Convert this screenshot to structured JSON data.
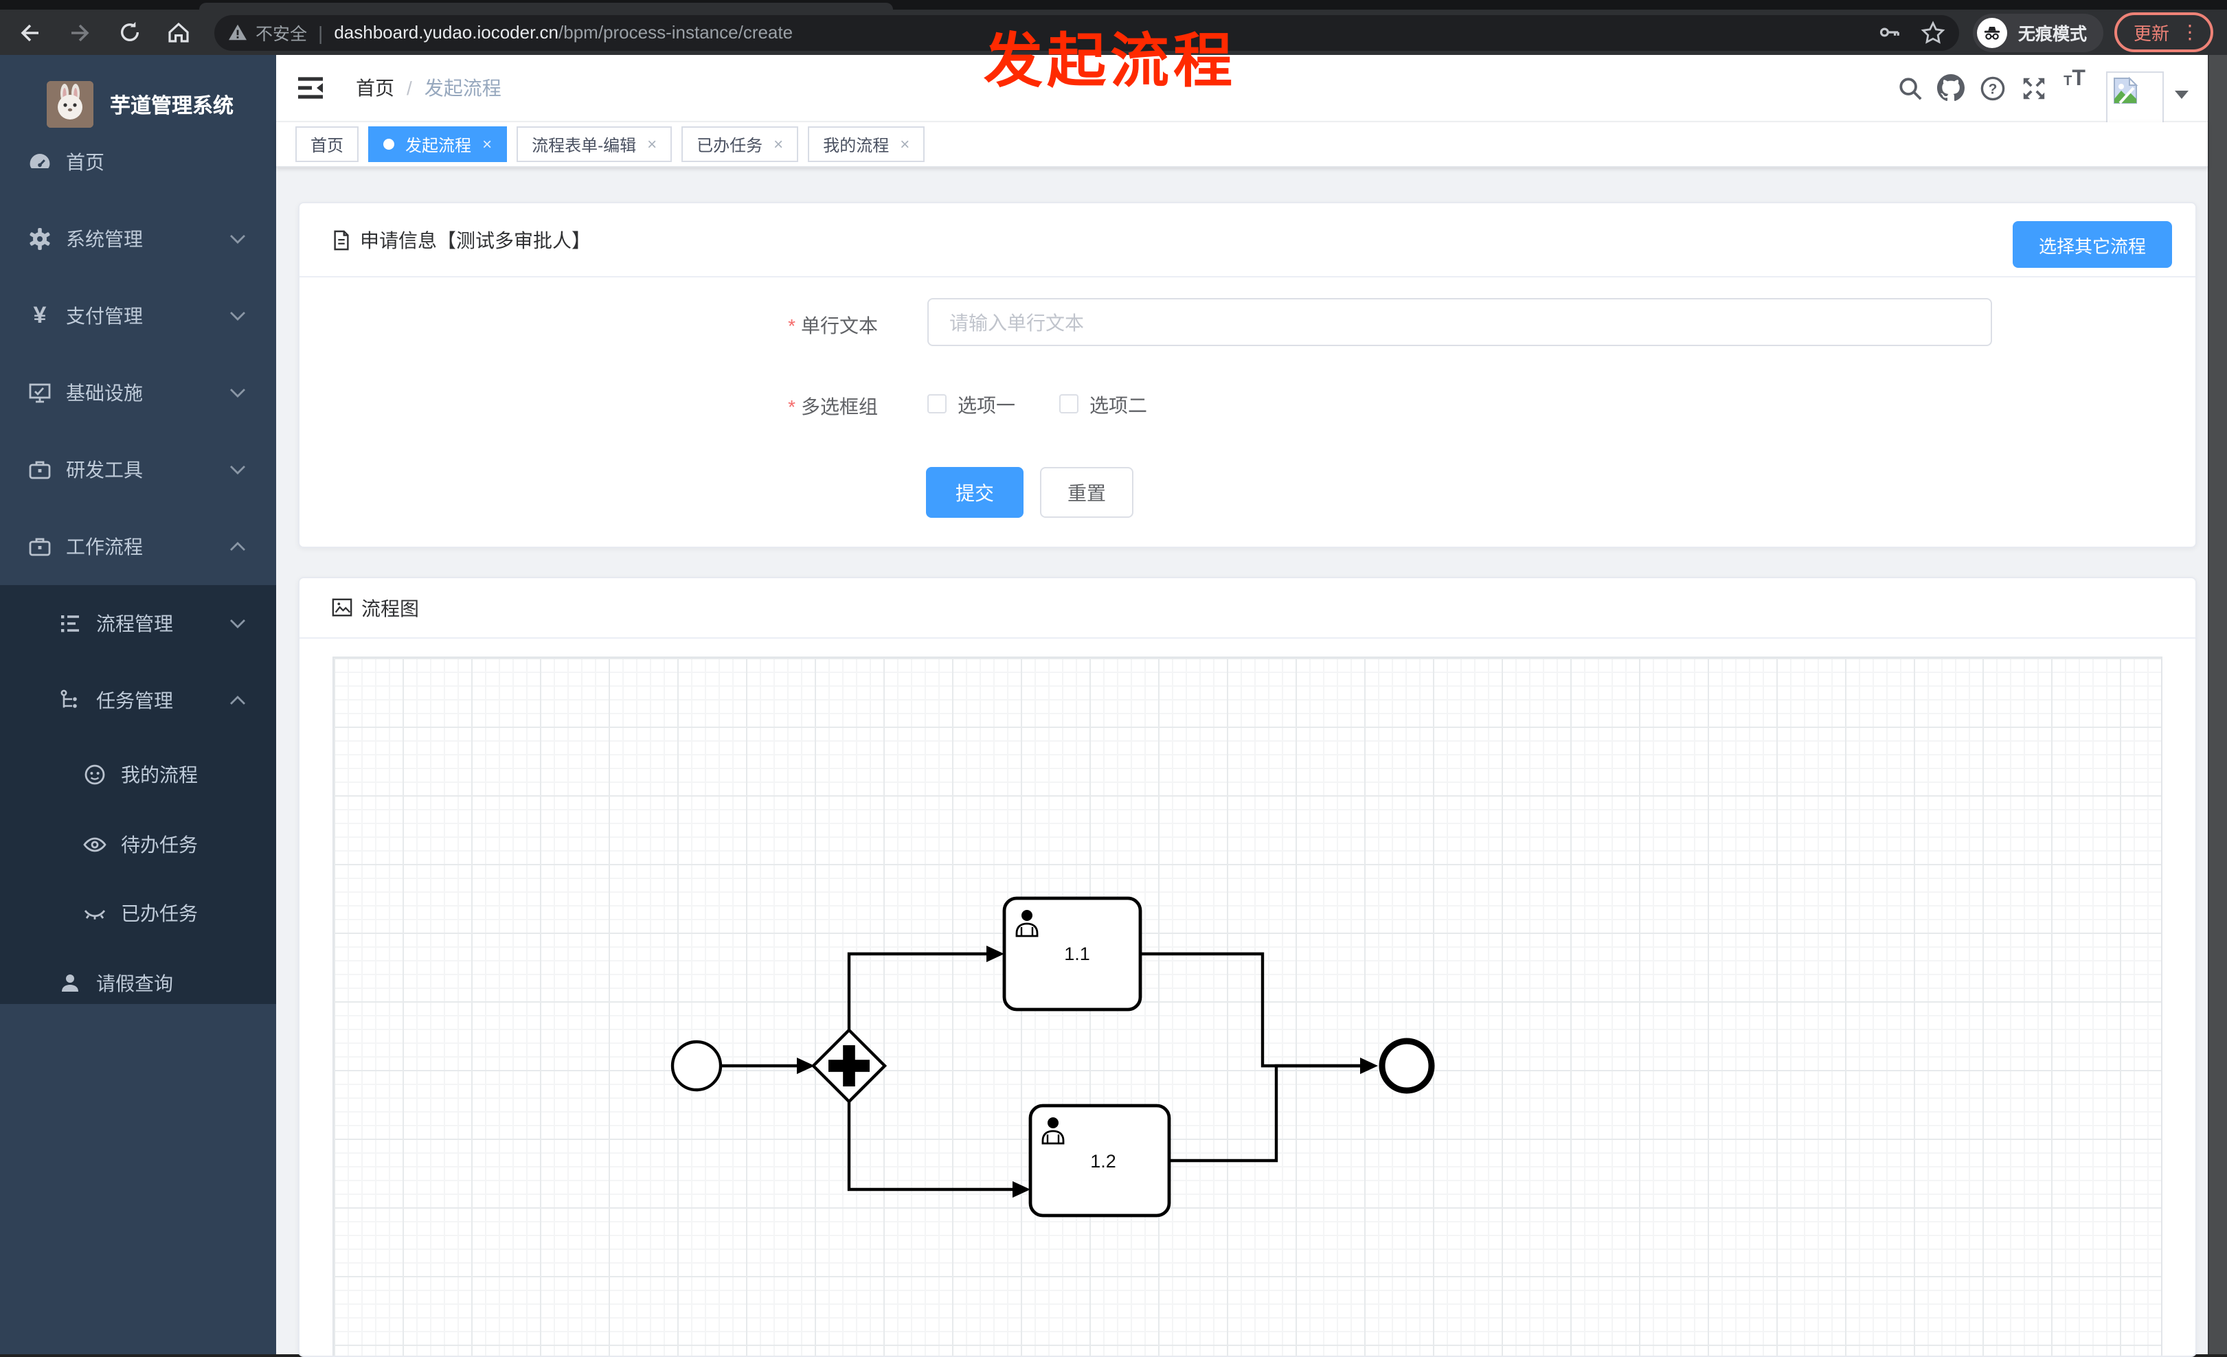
{
  "browser": {
    "security_label": "不安全",
    "url_host": "dashboard.yudao.iocoder.cn",
    "url_path": "/bpm/process-instance/create",
    "incognito_label": "无痕模式",
    "update_label": "更新"
  },
  "annotation": {
    "title": "发起流程",
    "color": "#ff2a00"
  },
  "sidebar": {
    "logo_title": "芋道管理系统",
    "items": [
      {
        "label": "首页",
        "icon": "dashboard"
      },
      {
        "label": "系统管理",
        "icon": "gear"
      },
      {
        "label": "支付管理",
        "icon": "yen"
      },
      {
        "label": "基础设施",
        "icon": "monitor"
      },
      {
        "label": "研发工具",
        "icon": "briefcase"
      },
      {
        "label": "工作流程",
        "icon": "briefcase",
        "expanded": true
      },
      {
        "label": "流程管理",
        "icon": "list"
      },
      {
        "label": "任务管理",
        "icon": "flow",
        "expanded": true
      },
      {
        "label": "我的流程",
        "icon": "face"
      },
      {
        "label": "待办任务",
        "icon": "eye"
      },
      {
        "label": "已办任务",
        "icon": "eye-off"
      },
      {
        "label": "请假查询",
        "icon": "user"
      }
    ]
  },
  "header": {
    "breadcrumb": [
      "首页",
      "发起流程"
    ],
    "separator": "/"
  },
  "tabs": [
    {
      "label": "首页"
    },
    {
      "label": "发起流程",
      "active": true
    },
    {
      "label": "流程表单-编辑"
    },
    {
      "label": "已办任务"
    },
    {
      "label": "我的流程"
    }
  ],
  "form_card": {
    "title": "申请信息【测试多审批人】",
    "select_other_button": "选择其它流程",
    "required_mark": "*",
    "fields": {
      "text": {
        "label": "单行文本",
        "placeholder": "请输入单行文本",
        "required": true
      },
      "checkbox_group": {
        "label": "多选框组",
        "required": true,
        "options": [
          "选项一",
          "选项二"
        ],
        "checked": [
          false,
          false
        ]
      }
    },
    "submit_label": "提交",
    "reset_label": "重置"
  },
  "diagram_card": {
    "title": "流程图",
    "chart_data": {
      "type": "bpmn-flow",
      "nodes": [
        {
          "id": "start",
          "type": "start-event"
        },
        {
          "id": "gateway",
          "type": "parallel-gateway"
        },
        {
          "id": "task1",
          "type": "user-task",
          "label": "1.1"
        },
        {
          "id": "task2",
          "type": "user-task",
          "label": "1.2"
        },
        {
          "id": "end",
          "type": "end-event"
        }
      ],
      "edges": [
        "start→gateway",
        "gateway→1.1",
        "gateway→1.2",
        "1.1→end",
        "1.2→end"
      ]
    },
    "nodes": {
      "task1": "1.1",
      "task2": "1.2"
    }
  },
  "colors": {
    "accent": "#409eff",
    "sidebar_bg": "#304156",
    "sidebar_submenu_bg": "#1f2d3d",
    "annotation_red": "#ff2a00",
    "update_red": "#ee8277",
    "required_red": "#f56c6c"
  }
}
